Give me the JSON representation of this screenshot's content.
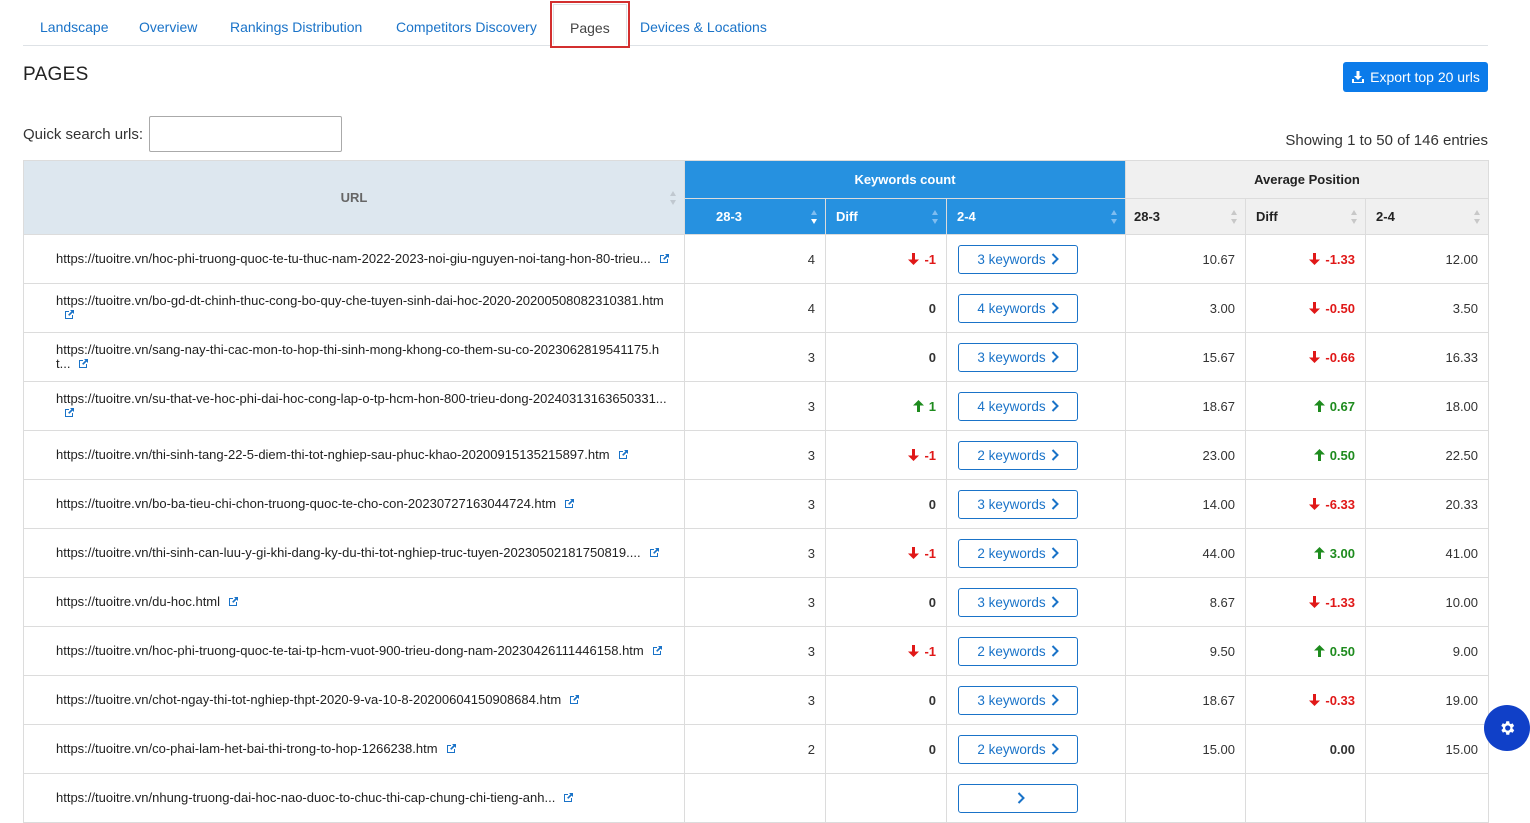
{
  "tabs": [
    {
      "label": "Landscape",
      "active": false
    },
    {
      "label": "Overview",
      "active": false
    },
    {
      "label": "Rankings Distribution",
      "active": false
    },
    {
      "label": "Competitors Discovery",
      "active": false
    },
    {
      "label": "Pages",
      "active": true
    },
    {
      "label": "Devices & Locations",
      "active": false
    }
  ],
  "page_title": "PAGES",
  "export_label": "Export top 20 urls",
  "search": {
    "label": "Quick search urls:",
    "value": "",
    "placeholder": ""
  },
  "showing_text": "Showing 1 to 50 of 146 entries",
  "table": {
    "url_header": "URL",
    "group_keywords": "Keywords count",
    "group_position": "Average Position",
    "sub_headers": {
      "first": "28-3",
      "diff": "Diff",
      "second": "2-4"
    },
    "rows": [
      {
        "url": "https://tuoitre.vn/hoc-phi-truong-quoc-te-tu-thuc-nam-2022-2023-noi-giu-nguyen-noi-tang-hon-80-trieu...",
        "kw_first": "4",
        "kw_diff": "-1",
        "kw_dir": "down",
        "keywords": "3 keywords",
        "pos_first": "10.67",
        "pos_diff": "-1.33",
        "pos_dir": "down",
        "pos_second": "12.00"
      },
      {
        "url": "https://tuoitre.vn/bo-gd-dt-chinh-thuc-cong-bo-quy-che-tuyen-sinh-dai-hoc-2020-20200508082310381.htm",
        "kw_first": "4",
        "kw_diff": "0",
        "kw_dir": "none",
        "keywords": "4 keywords",
        "pos_first": "3.00",
        "pos_diff": "-0.50",
        "pos_dir": "down",
        "pos_second": "3.50"
      },
      {
        "url": "https://tuoitre.vn/sang-nay-thi-cac-mon-to-hop-thi-sinh-mong-khong-co-them-su-co-2023062819541175.ht...",
        "kw_first": "3",
        "kw_diff": "0",
        "kw_dir": "none",
        "keywords": "3 keywords",
        "pos_first": "15.67",
        "pos_diff": "-0.66",
        "pos_dir": "down",
        "pos_second": "16.33"
      },
      {
        "url": "https://tuoitre.vn/su-that-ve-hoc-phi-dai-hoc-cong-lap-o-tp-hcm-hon-800-trieu-dong-20240313163650331...",
        "kw_first": "3",
        "kw_diff": "1",
        "kw_dir": "up",
        "keywords": "4 keywords",
        "pos_first": "18.67",
        "pos_diff": "0.67",
        "pos_dir": "up",
        "pos_second": "18.00"
      },
      {
        "url": "https://tuoitre.vn/thi-sinh-tang-22-5-diem-thi-tot-nghiep-sau-phuc-khao-20200915135215897.htm",
        "kw_first": "3",
        "kw_diff": "-1",
        "kw_dir": "down",
        "keywords": "2 keywords",
        "pos_first": "23.00",
        "pos_diff": "0.50",
        "pos_dir": "up",
        "pos_second": "22.50"
      },
      {
        "url": "https://tuoitre.vn/bo-ba-tieu-chi-chon-truong-quoc-te-cho-con-20230727163044724.htm",
        "kw_first": "3",
        "kw_diff": "0",
        "kw_dir": "none",
        "keywords": "3 keywords",
        "pos_first": "14.00",
        "pos_diff": "-6.33",
        "pos_dir": "down",
        "pos_second": "20.33"
      },
      {
        "url": "https://tuoitre.vn/thi-sinh-can-luu-y-gi-khi-dang-ky-du-thi-tot-nghiep-truc-tuyen-20230502181750819....",
        "kw_first": "3",
        "kw_diff": "-1",
        "kw_dir": "down",
        "keywords": "2 keywords",
        "pos_first": "44.00",
        "pos_diff": "3.00",
        "pos_dir": "up",
        "pos_second": "41.00"
      },
      {
        "url": "https://tuoitre.vn/du-hoc.html",
        "kw_first": "3",
        "kw_diff": "0",
        "kw_dir": "none",
        "keywords": "3 keywords",
        "pos_first": "8.67",
        "pos_diff": "-1.33",
        "pos_dir": "down",
        "pos_second": "10.00"
      },
      {
        "url": "https://tuoitre.vn/hoc-phi-truong-quoc-te-tai-tp-hcm-vuot-900-trieu-dong-nam-20230426111446158.htm",
        "kw_first": "3",
        "kw_diff": "-1",
        "kw_dir": "down",
        "keywords": "2 keywords",
        "pos_first": "9.50",
        "pos_diff": "0.50",
        "pos_dir": "up",
        "pos_second": "9.00"
      },
      {
        "url": "https://tuoitre.vn/chot-ngay-thi-tot-nghiep-thpt-2020-9-va-10-8-20200604150908684.htm",
        "kw_first": "3",
        "kw_diff": "0",
        "kw_dir": "none",
        "keywords": "3 keywords",
        "pos_first": "18.67",
        "pos_diff": "-0.33",
        "pos_dir": "down",
        "pos_second": "19.00"
      },
      {
        "url": "https://tuoitre.vn/co-phai-lam-het-bai-thi-trong-to-hop-1266238.htm",
        "kw_first": "2",
        "kw_diff": "0",
        "kw_dir": "none",
        "keywords": "2 keywords",
        "pos_first": "15.00",
        "pos_diff": "0.00",
        "pos_dir": "none",
        "pos_second": "15.00"
      },
      {
        "url": "https://tuoitre.vn/nhung-truong-dai-hoc-nao-duoc-to-chuc-thi-cap-chung-chi-tieng-anh...",
        "kw_first": "",
        "kw_diff": "",
        "kw_dir": "none",
        "keywords": "",
        "pos_first": "",
        "pos_diff": "",
        "pos_dir": "none",
        "pos_second": ""
      }
    ]
  },
  "colors": {
    "accent": "#0b7bea",
    "header_blue": "#2691e0",
    "up": "#1e8b1e",
    "down": "#e01818",
    "gear": "#1040c8",
    "highlight": "#d32f2f"
  },
  "icons": {
    "export": "download-icon",
    "external": "external-link-icon",
    "chevron": "chevron-right-icon",
    "settings": "gear-icon"
  }
}
